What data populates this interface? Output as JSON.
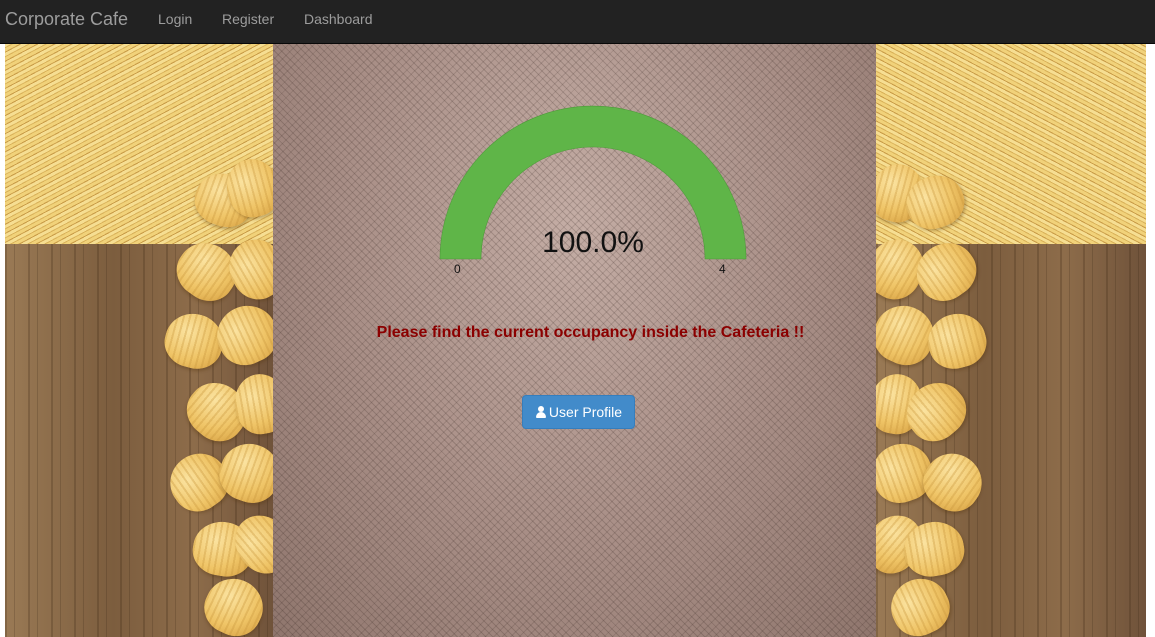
{
  "navbar": {
    "brand": "Corporate Cafe",
    "links": [
      "Login",
      "Register",
      "Dashboard"
    ]
  },
  "gauge": {
    "value_text": "100.0%",
    "fraction": 1.0,
    "min": "0",
    "max": "4",
    "color": "#5fb548",
    "track_color": "#cccccc"
  },
  "message": "Please find the current occupancy inside the Cafeteria !!",
  "profile_button": {
    "icon": "user-icon",
    "label": "User Profile"
  },
  "colors": {
    "navbar_bg": "#222222",
    "nav_text": "#9d9d9d",
    "message_text": "#8b0000",
    "button_bg": "#428bca"
  }
}
